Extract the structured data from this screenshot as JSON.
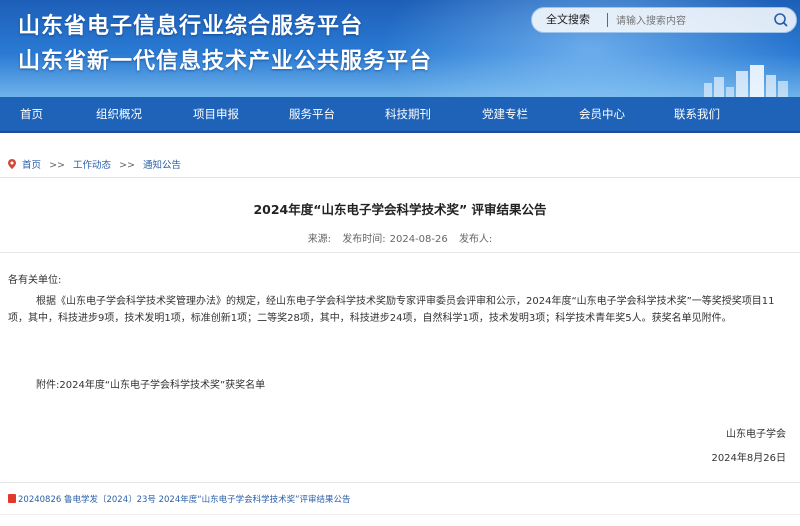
{
  "header": {
    "title_line1": "山东省电子信息行业综合服务平台",
    "title_line2": "山东省新一代信息技术产业公共服务平台",
    "search": {
      "type_label": "全文搜索",
      "placeholder": "请输入搜索内容",
      "icon": "search-icon"
    }
  },
  "nav": {
    "items": [
      "首页",
      "组织概况",
      "项目申报",
      "服务平台",
      "科技期刊",
      "党建专栏",
      "会员中心",
      "联系我们"
    ]
  },
  "breadcrumb": {
    "icon": "location-pin-icon",
    "items": [
      "首页",
      "工作动态",
      "通知公告"
    ],
    "separator": ">>"
  },
  "article": {
    "title": "2024年度“山东电子学会科学技术奖” 评审结果公告",
    "meta": {
      "source_label": "来源:",
      "date_label": "发布时间:",
      "date": "2024-08-26",
      "publisher_label": "发布人:"
    },
    "salutation": "各有关单位:",
    "body": "根据《山东电子学会科学技术奖管理办法》的规定，经山东电子学会科学技术奖励专家评审委员会评审和公示，2024年度“山东电子学会科学技术奖”一等奖授奖项目11项，其中，科技进步9项，技术发明1项，标准创新1项；二等奖28项，其中，科技进步24项，自然科学1项，技术发明3项；科学技术青年奖5人。获奖名单见附件。",
    "attachment": "附件:2024年度“山东电子学会科学技术奖”获奖名单",
    "signature_org": "山东电子学会",
    "signature_date": "2024年8月26日"
  },
  "attachment_file": {
    "icon": "pdf-file-icon",
    "label": "20240826 鲁电学发〔2024〕23号 2024年度“山东电子学会科学技术奖”评审结果公告"
  },
  "colors": {
    "header_blue": "#2a7ad4",
    "nav_blue": "#1e63b8",
    "link_blue": "#2a5fa8"
  }
}
